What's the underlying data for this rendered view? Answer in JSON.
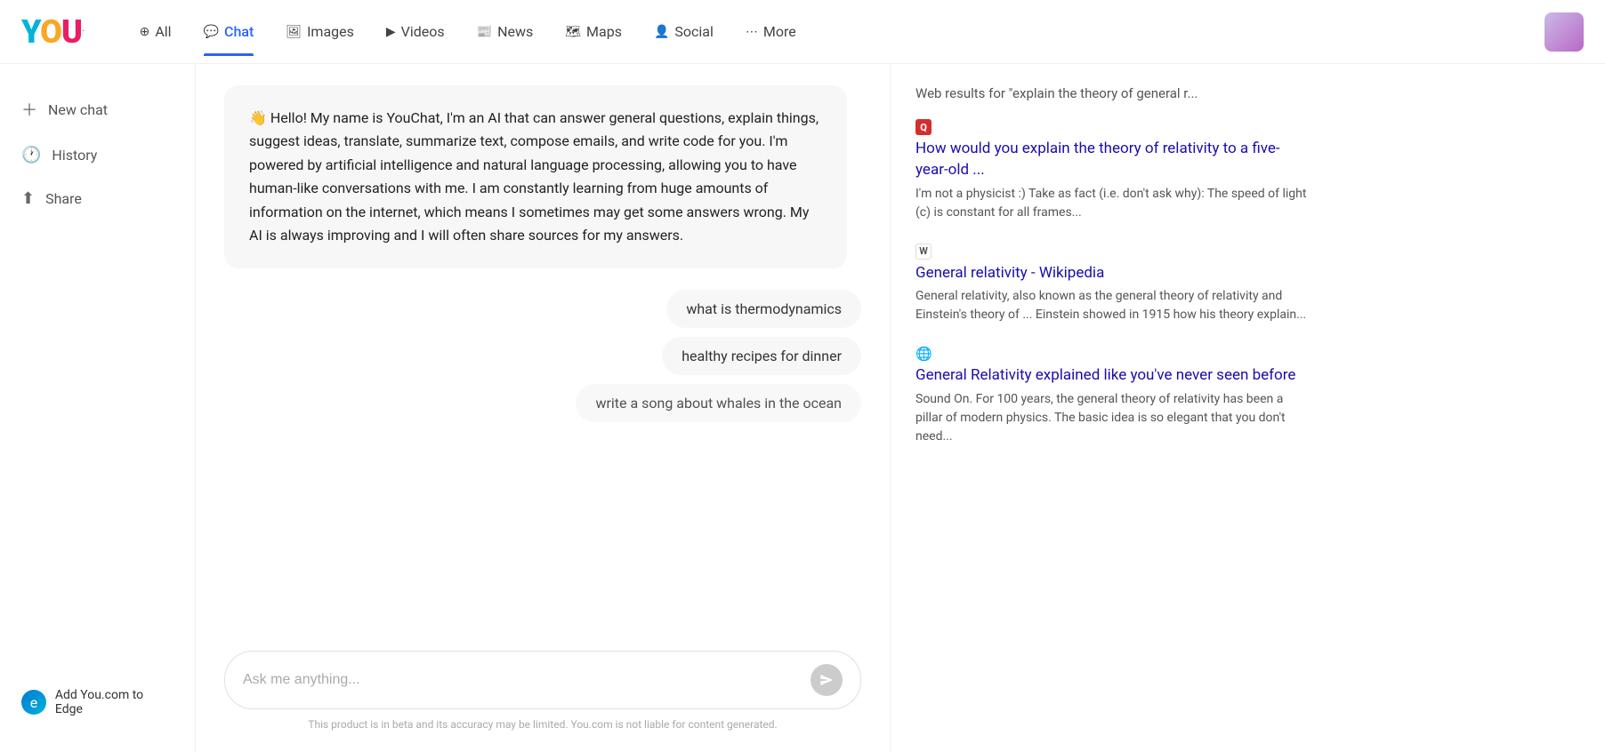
{
  "logo": {
    "y": "Y",
    "o": "O",
    "u": "U",
    "dot": "."
  },
  "nav": {
    "items": [
      {
        "id": "all",
        "label": "All",
        "icon": "⊕",
        "active": false
      },
      {
        "id": "chat",
        "label": "Chat",
        "icon": "💬",
        "active": true
      },
      {
        "id": "images",
        "label": "Images",
        "icon": "🖼",
        "active": false
      },
      {
        "id": "videos",
        "label": "Videos",
        "icon": "▶",
        "active": false
      },
      {
        "id": "news",
        "label": "News",
        "icon": "📰",
        "active": false
      },
      {
        "id": "maps",
        "label": "Maps",
        "icon": "🗺",
        "active": false
      },
      {
        "id": "social",
        "label": "Social",
        "icon": "👤",
        "active": false
      },
      {
        "id": "more",
        "label": "More",
        "icon": "⋯",
        "active": false
      }
    ]
  },
  "sidebar": {
    "new_chat": "New chat",
    "history": "History",
    "share": "Share",
    "edge_promo": "Add You.com to Edge"
  },
  "chat": {
    "bot_message": "👋 Hello! My name is YouChat, I'm an AI that can answer general questions, explain things, suggest ideas, translate, summarize text, compose emails, and write code for you. I'm powered by artificial intelligence and natural language processing, allowing you to have human-like conversations with me. I am constantly learning from huge amounts of information on the internet, which means I sometimes may get some answers wrong. My AI is always improving and I will often share sources for my answers.",
    "suggestions": [
      "what is thermodynamics",
      "healthy recipes for dinner",
      "write a song about whales in the ocean"
    ],
    "input_placeholder": "Ask me anything...",
    "disclaimer": "This product is in beta and its accuracy may be limited. You.com is not liable for content generated."
  },
  "results": {
    "title": "Web results for \"explain the theory of general r...",
    "items": [
      {
        "favicon_type": "q",
        "favicon_label": "Q",
        "link": "How would you explain the theory of relativity to a five-year-old ...",
        "snippet": "I'm not a physicist :) Take as fact (i.e. don't ask why): The speed of light (c) is constant for all frames..."
      },
      {
        "favicon_type": "w",
        "favicon_label": "W",
        "link": "General relativity - Wikipedia",
        "snippet": "General relativity, also known as the general theory of relativity and Einstein's theory of ... Einstein showed in 1915 how his theory explain..."
      },
      {
        "favicon_type": "globe",
        "favicon_label": "🌐",
        "link": "General Relativity explained like you've never seen before",
        "snippet": "Sound On. For 100 years, the general theory of relativity has been a pillar of modern physics. The basic idea is so elegant that you don't need..."
      }
    ]
  }
}
